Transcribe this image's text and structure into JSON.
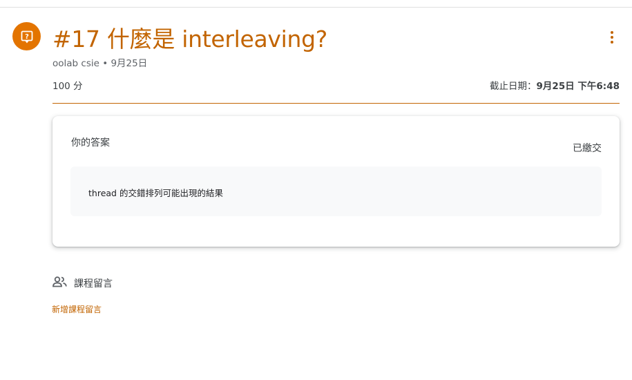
{
  "assignment": {
    "icon": "assignment-question-icon",
    "title": "#17 什麼是 interleaving?",
    "author": "oolab csie",
    "separator": " • ",
    "posted_date": "9月25日",
    "points": "100 分",
    "due_label": "截止日期：",
    "due_date": "9月25日",
    "due_time": " 下午6:48",
    "accent_color": "#c26401",
    "icon_bg_color": "#e37400"
  },
  "work": {
    "title": "你的答案",
    "status": "已繳交",
    "answer": "thread 的交錯排列可能出現的結果"
  },
  "comments": {
    "icon": "people-icon",
    "title": "課程留言",
    "add_link": "新增課程留言"
  }
}
